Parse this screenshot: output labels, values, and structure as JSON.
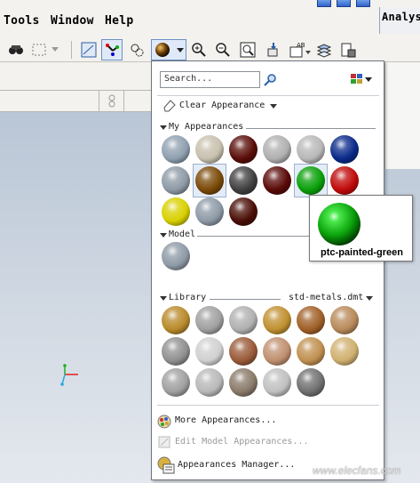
{
  "menubar": {
    "items": [
      "Tools",
      "Window",
      "Help"
    ],
    "right_tab_partial": "Analys"
  },
  "toolbar": {
    "icons": [
      "binoculars-icon",
      "select-box-icon",
      "dropdown-arrow-icon",
      "datum-display-icon",
      "spin-center-icon",
      "hidden-lines-icon",
      "appearance-sphere-icon",
      "zoom-in-icon",
      "zoom-out-icon",
      "refit-icon",
      "reorient-icon",
      "saved-views-icon",
      "layers-icon",
      "model-display-icon"
    ]
  },
  "popup": {
    "search_placeholder": "Search...",
    "clear_appearance": "Clear Appearance",
    "sections": {
      "my_appearances": "My Appearances",
      "model": "Model",
      "library": "Library",
      "library_file": "std-metals.dmt"
    },
    "my_appearances_colors": [
      [
        "#8fa0b0",
        "#c8c0ae",
        "#5a0d08",
        "#b0b0b0",
        "#b8b8b8",
        "#0a2a8a"
      ],
      [
        "#8e9aa6",
        "#7a4a08",
        "#404040",
        "#5a0a08",
        "#0aa00a",
        "#c00a0a"
      ],
      [
        "#d8d000",
        "#8e9aa6",
        "#4a0e06"
      ]
    ],
    "model_colors": [
      "#8e9aa6"
    ],
    "library_colors": [
      [
        "#b88a2a",
        "#a0a0a0",
        "#b0b0b0",
        "#c09030",
        "#a06028",
        "#b88a5a"
      ],
      [
        "#909090",
        "#d0d0d0",
        "#9a5a3a",
        "#c09070",
        "#c09050",
        "#d0b070"
      ],
      [
        "#a0a0a0",
        "#b8b8b8",
        "#8a7a6a",
        "#c0c0c0",
        "#707070"
      ]
    ],
    "footer": {
      "more": "More Appearances...",
      "edit": "Edit Model Appearances...",
      "manager": "Appearances Manager..."
    }
  },
  "tooltip": {
    "label": "ptc-painted-green",
    "color": "#0aa00a"
  },
  "watermark": "www.elecfans.com"
}
